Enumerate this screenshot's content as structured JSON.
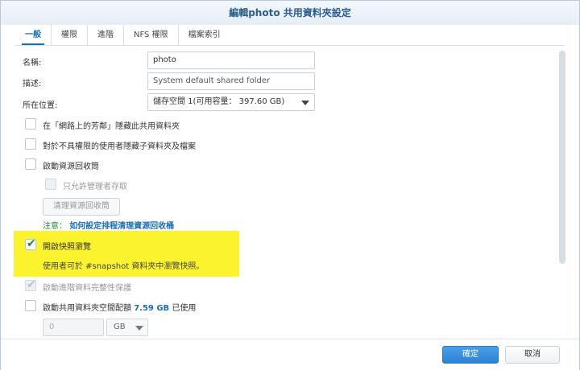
{
  "window": {
    "title": "編輯photo 共用資料夾設定"
  },
  "tabs": [
    {
      "label": "一般"
    },
    {
      "label": "權限"
    },
    {
      "label": "進階"
    },
    {
      "label": "NFS 權限"
    },
    {
      "label": "檔案索引"
    }
  ],
  "form": {
    "name_label": "名稱:",
    "name_value": "photo",
    "desc_label": "描述:",
    "desc_value": "System default shared folder",
    "location_label": "所在位置:",
    "location_value": "儲存空間 1(可用容量： 397.60 GB)"
  },
  "options": {
    "hide_network": "在「網路上的芳鄰」隱藏此共用資料夾",
    "hide_subfolders": "對於不具權限的使用者隱藏子資料夾及檔案",
    "recycle_bin": "啟動資源回收筒",
    "admin_only": "只允許管理者存取",
    "clean_button": "清理資源回收筒",
    "note_prefix": "注意：",
    "note_link": "如何設定排程清理資源回收桶",
    "snapshot_browse": "開啟快照瀏覽",
    "snapshot_desc": "使用者可於 #snapshot 資料夾中瀏覽快照。",
    "integrity": "啟動進階資料完整性保護",
    "quota_label": "啟動共用資料夾空間配額",
    "quota_used_value": "7.59 GB",
    "quota_used_suffix": "已使用",
    "quota_input": "0",
    "quota_unit": "GB"
  },
  "footer": {
    "ok": "確定",
    "cancel": "取消"
  },
  "colors": {
    "accent": "#1a6fb5",
    "highlight": "#fbf32e",
    "check": "#1c8a2d"
  }
}
